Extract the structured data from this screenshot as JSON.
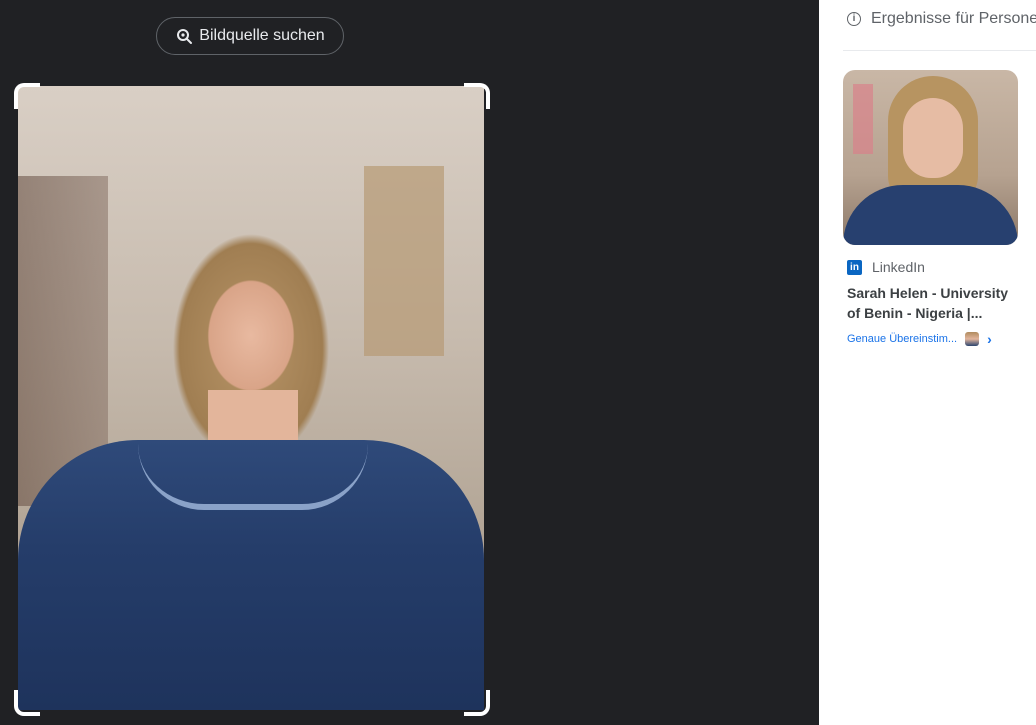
{
  "toolbar": {
    "source_button_label": "Bildquelle suchen"
  },
  "results": {
    "header": "Ergebnisse für Personen",
    "items": [
      {
        "source": "LinkedIn",
        "title": "Sarah Helen - University of Benin - Nigeria |...",
        "match_label": "Genaue Übereinstim..."
      }
    ]
  },
  "icons": {
    "source_button": "lens-search-icon",
    "header": "info-icon",
    "source": "linkedin-icon",
    "match": "chevron-right-icon"
  },
  "colors": {
    "left_background": "#202124",
    "right_background": "#ffffff",
    "link_blue": "#1a73e8",
    "linkedin_blue": "#0a66c2"
  }
}
